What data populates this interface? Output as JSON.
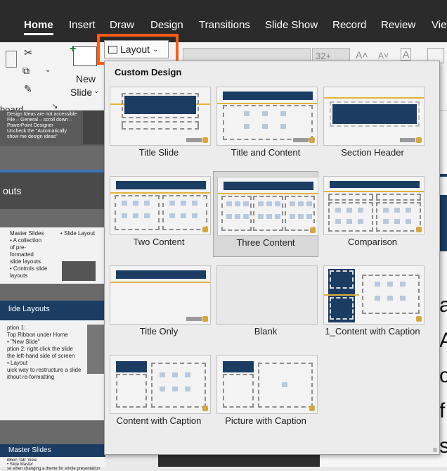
{
  "ribbon": {
    "tabs": [
      "Home",
      "Insert",
      "Draw",
      "Design",
      "Transitions",
      "Slide Show",
      "Record",
      "Review",
      "View"
    ],
    "active_tab": "Home",
    "new_slide_label_1": "New",
    "new_slide_label_2": "Slide",
    "board_label": "board",
    "layout_label": "Layout",
    "font_size_value": "32+"
  },
  "dropdown": {
    "title": "Custom Design",
    "layouts": [
      {
        "label": "Title Slide"
      },
      {
        "label": "Title and Content"
      },
      {
        "label": "Section Header"
      },
      {
        "label": "Two Content"
      },
      {
        "label": "Three Content"
      },
      {
        "label": "Comparison"
      },
      {
        "label": "Title Only"
      },
      {
        "label": "Blank"
      },
      {
        "label": "1_Content with Caption"
      },
      {
        "label": "Content with Caption"
      },
      {
        "label": "Picture with Caption"
      }
    ],
    "selected": "Three Content"
  },
  "left_panel": {
    "thumb1_text": "Design Ideas are not accessible\nFile – General – scroll down –\nPowerPoint Designer\nUncheck the \"Automatically\nshow me design ideas\"",
    "thumb2_title": "outs",
    "thumb3_col1": "Master Slides\n• A collection\nof pre-\nformatted\nslide layouts\n• Controls slide\nlayouts",
    "thumb3_col2": "• Slide Layout",
    "thumb4_title": "lide Layouts",
    "thumb4_text": "ption 1:\nTop Ribbon under Home\n• \"New Slide\"\nption 2: right click the slide\nthe left-hand side of screen\n• Layout\nuick way to restructure a slide\nithout re-formatting",
    "thumb5_title": "Master Slides",
    "thumb5_text": "ibbon Tab: View\n• Slide Master\nse when changing a theme for whole presentation"
  },
  "right_slide": {
    "letters": [
      "a",
      "A",
      "c",
      "f",
      "s"
    ]
  },
  "colors": {
    "accent": "#ff5b14",
    "navy": "#1b3c63",
    "gold": "#e0b33a"
  }
}
